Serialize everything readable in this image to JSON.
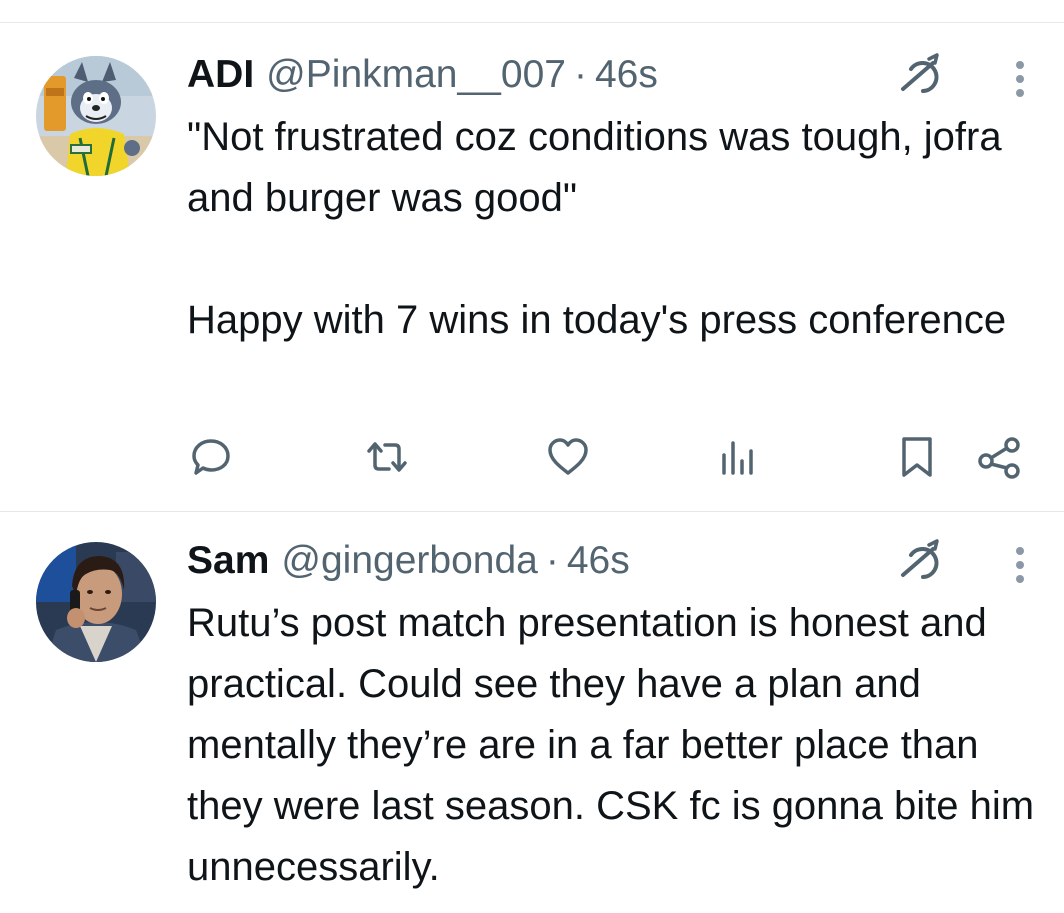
{
  "tweets": [
    {
      "display_name": "ADI",
      "handle": "@Pinkman__007",
      "separator": "·",
      "time": "46s",
      "avatar_icon": "cartoon-cat-avatar",
      "text": "\"Not frustrated coz conditions was tough, jofra and burger was good\"\n\nHappy with 7 wins in today's press conference",
      "actions": [
        "reply-icon",
        "retweet-icon",
        "like-icon",
        "views-icon",
        "bookmark-icon",
        "share-icon"
      ]
    },
    {
      "display_name": "Sam",
      "handle": "@gingerbonda",
      "separator": "·",
      "time": "46s",
      "avatar_icon": "man-on-phone-avatar",
      "text": "Rutu’s post match presentation is honest and practical. Could see they have a plan and mentally they’re are in a far better place than they were last season. CSK fc is gonna bite him unnecessarily."
    }
  ],
  "colors": {
    "text_primary": "#0f1419",
    "text_secondary": "#536471",
    "divider": "#e6e9ec"
  }
}
